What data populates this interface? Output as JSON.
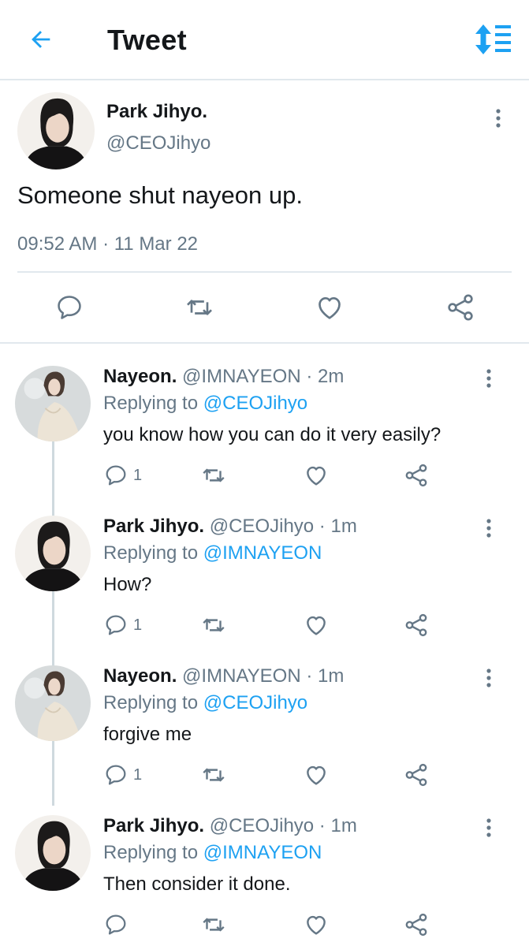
{
  "header": {
    "title": "Tweet",
    "back_icon": "arrow-left-icon",
    "sort_icon": "sort-icon"
  },
  "colors": {
    "accent": "#1da1f2",
    "secondary_text": "#657786",
    "border": "#e1e8ed"
  },
  "main_tweet": {
    "name": "Park Jihyo.",
    "handle": "@CEOJihyo",
    "text": "Someone shut nayeon up.",
    "timestamp": "09:52 AM · 11 Mar 22"
  },
  "replies": [
    {
      "name": "Nayeon.",
      "handle": "@IMNAYEON",
      "sep": " · ",
      "time": "2m",
      "replying_prefix": "Replying to ",
      "replying_to": "@CEOJihyo",
      "text": "you know how you can do it very easily?",
      "reply_count": "1"
    },
    {
      "name": "Park Jihyo.",
      "handle": "@CEOJihyo",
      "sep": " · ",
      "time": "1m",
      "replying_prefix": "Replying to ",
      "replying_to": "@IMNAYEON",
      "text": "How?",
      "reply_count": "1"
    },
    {
      "name": "Nayeon.",
      "handle": "@IMNAYEON",
      "sep": " · ",
      "time": "1m",
      "replying_prefix": "Replying to ",
      "replying_to": "@CEOJihyo",
      "text": "forgive me",
      "reply_count": "1"
    },
    {
      "name": "Park Jihyo.",
      "handle": "@CEOJihyo",
      "sep": " · ",
      "time": "1m",
      "replying_prefix": "Replying to ",
      "replying_to": "@IMNAYEON",
      "text": "Then consider it done.",
      "reply_count": ""
    }
  ]
}
